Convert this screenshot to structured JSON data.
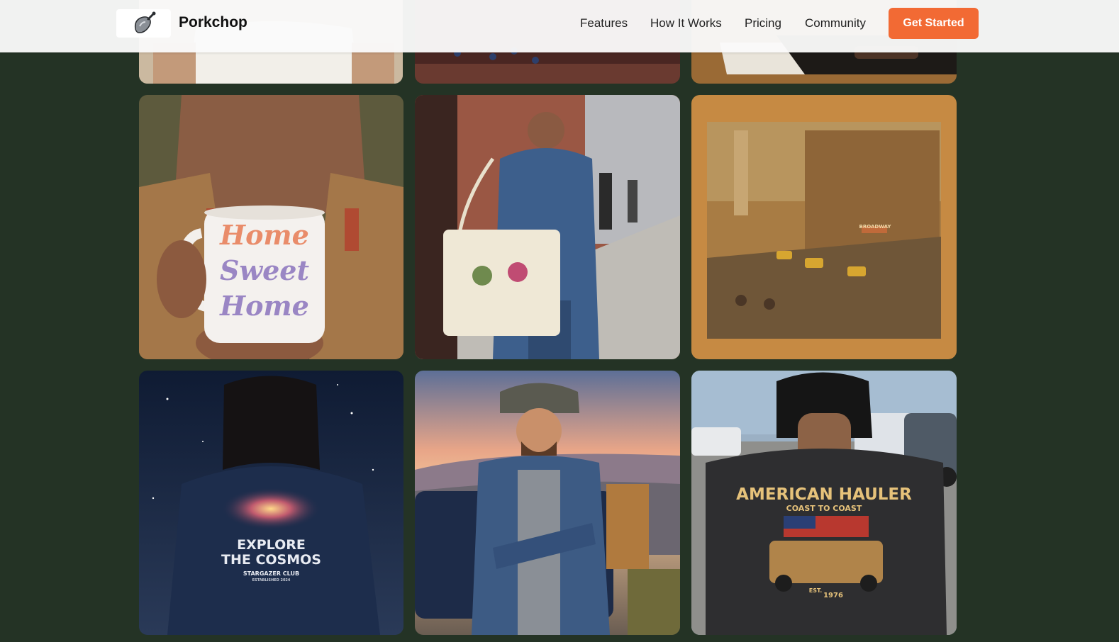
{
  "brand": {
    "name": "Porkchop",
    "logo_icon": "pork-chop-icon"
  },
  "nav": {
    "links": [
      "Features",
      "How It Works",
      "Pricing",
      "Community"
    ],
    "cta_label": "Get Started"
  },
  "colors": {
    "background": "#243325",
    "accent": "#f26a34"
  },
  "gallery": {
    "mug": {
      "lines": [
        "Home",
        "Sweet",
        "Home"
      ]
    },
    "cosmos": {
      "line1": "EXPLORE",
      "line2": "THE COSMOS",
      "club": "STARGAZER CLUB",
      "est": "ESTABLISHED 2024"
    },
    "hauler": {
      "title": "AMERICAN HAULER",
      "subtitle": "COAST TO COAST",
      "est": "EST.",
      "year": "1976"
    },
    "puzzle": {
      "sign": "BROADWAY"
    }
  }
}
